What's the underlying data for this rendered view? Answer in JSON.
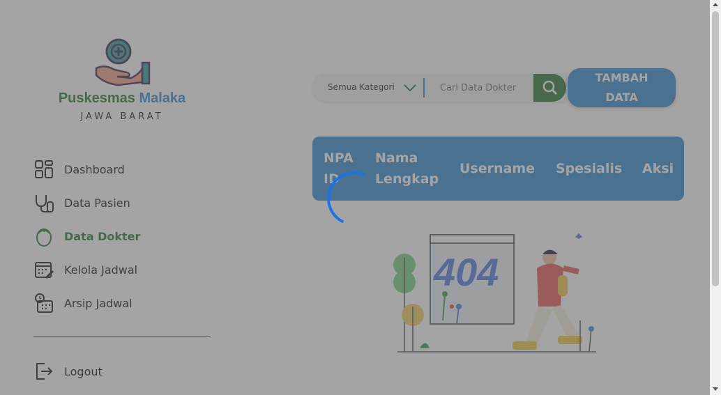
{
  "brand": {
    "name_part1": "Puskesmas",
    "name_part2": "Malaka",
    "subtitle": "JAWA BARAT"
  },
  "sidebar": {
    "items": [
      {
        "label": "Dashboard",
        "icon": "dashboard-icon"
      },
      {
        "label": "Data Pasien",
        "icon": "stethoscope-icon"
      },
      {
        "label": "Data Dokter",
        "icon": "doctor-icon",
        "active": true
      },
      {
        "label": "Kelola Jadwal",
        "icon": "calendar-edit-icon"
      },
      {
        "label": "Arsip Jadwal",
        "icon": "calendar-clock-icon"
      }
    ],
    "logout_label": "Logout"
  },
  "toolbar": {
    "category_label": "Semua Kategori",
    "search_placeholder": "Cari Data Dokter",
    "add_label_line1": "TAMBAH",
    "add_label_line2": "DATA"
  },
  "table": {
    "headers": [
      {
        "line1": "NPA",
        "line2": "ID"
      },
      {
        "line1": "Nama",
        "line2": "Lengkap"
      },
      {
        "line1": "Username",
        "line2": ""
      },
      {
        "line1": "Spesialis",
        "line2": ""
      },
      {
        "line1": "Aksi",
        "line2": ""
      }
    ]
  },
  "empty_state": {
    "illustration_text": "404"
  },
  "colors": {
    "green": "#2f7d3c",
    "blue": "#3a8fd2",
    "spinner": "#1a73e8"
  }
}
